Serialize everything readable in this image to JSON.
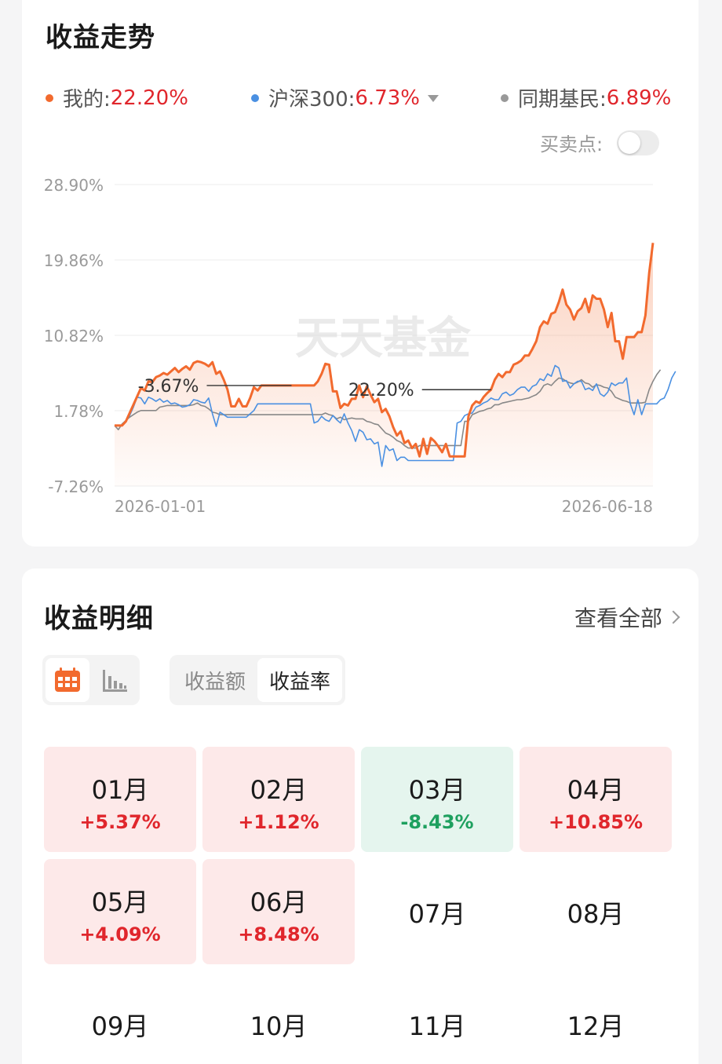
{
  "trend": {
    "title": "收益走势",
    "legend": [
      {
        "dot_color": "#f26a2e",
        "label": "我的:",
        "value": "22.20%"
      },
      {
        "dot_color": "#4a90e2",
        "label": "沪深300:",
        "value": "6.73%",
        "dropdown": true
      },
      {
        "dot_color": "#999999",
        "label": "同期基民:",
        "value": "6.89%"
      }
    ],
    "trade_point_label": "买卖点:",
    "trade_point_enabled": false,
    "watermark": "天天基金"
  },
  "chart_data": {
    "type": "line",
    "y_ticks": [
      "28.90%",
      "19.86%",
      "10.82%",
      "1.78%",
      "-7.26%"
    ],
    "ylim": [
      -7.26,
      28.9
    ],
    "x_tick_labels": [
      "2026-01-01",
      "2026-06-18"
    ],
    "annotations": [
      {
        "text": "22.20%",
        "series": "我的",
        "index": 100
      },
      {
        "text": "-3.67%",
        "series": "我的",
        "index": 47
      }
    ],
    "series": [
      {
        "name": "我的",
        "color": "#f26a2e",
        "values": [
          0,
          0,
          0,
          0.5,
          1.5,
          2.5,
          3.5,
          4.5,
          4.2,
          5.3,
          5.2,
          5.8,
          6,
          6.3,
          6.1,
          6.5,
          6.9,
          6.4,
          6.8,
          7.1,
          6.7,
          7.5,
          7.7,
          7.6,
          7.4,
          7.1,
          7.6,
          6.2,
          6.5,
          5.5,
          4.3,
          2.3,
          2.3,
          3.2,
          2.3,
          2.3,
          3.3,
          4.6,
          4.2,
          4.8,
          4.8,
          4.8,
          4.8,
          4.8,
          4.8,
          4.8,
          4.8,
          4.8,
          4.8,
          4.8,
          4.8,
          4.8,
          4.8,
          4.8,
          5.3,
          6.2,
          7.4,
          7.3,
          4.1,
          4.1,
          2.1,
          2.6,
          2.4,
          3.2,
          3.2,
          4.8,
          3.4,
          4.7,
          3.7,
          2.8,
          3.2,
          1.6,
          2,
          1.1,
          -0.2,
          -1.2,
          -0.7,
          -2.1,
          -1.8,
          -2.7,
          -2.2,
          -3.7,
          -1.6,
          -3.4,
          -1.5,
          -1.9,
          -2.5,
          -3.2,
          -2.2,
          -3.7,
          -3.7,
          -3.7,
          -3.7,
          -3.7,
          1.1,
          2.4,
          2.9,
          2.7,
          3.4,
          3.9,
          4.3,
          5.5,
          6.2,
          5.8,
          6.4,
          6.4,
          7.3,
          7.5,
          7.8,
          8.4,
          8.4,
          9.2,
          10.1,
          11.8,
          12.5,
          12.2,
          13.4,
          13.6,
          14.8,
          16.3,
          14.5,
          13.9,
          12.7,
          13.7,
          14.1,
          15.2,
          13.6,
          15.6,
          15.2,
          15.2,
          13.9,
          11.8,
          13.5,
          10.1,
          10.1,
          8,
          10.6,
          10.6,
          10.6,
          11.2,
          11.2,
          13.2,
          18.3,
          21.9
        ]
      },
      {
        "name": "沪深300",
        "color": "#4a90e2",
        "values": [
          0,
          0,
          0,
          0.5,
          1.2,
          2.2,
          3.4,
          3.3,
          2.6,
          3.4,
          3.2,
          2.9,
          3.2,
          2.8,
          3,
          2.6,
          2.7,
          2.5,
          2.2,
          2.3,
          2.5,
          3.1,
          3,
          2.8,
          2.7,
          3.3,
          1.4,
          -0.1,
          1.6,
          1.3,
          1,
          1,
          1,
          1,
          1,
          1,
          1.4,
          1.8,
          2.6,
          2.6,
          2.6,
          2.6,
          2.6,
          2.6,
          2.6,
          2.6,
          2.6,
          2.6,
          2.6,
          2.6,
          2.6,
          2.6,
          2.6,
          0.3,
          0.5,
          1.1,
          0.7,
          0.5,
          1.2,
          0.7,
          0.3,
          1.4,
          0.3,
          -0.6,
          -1.9,
          -0.5,
          -0.8,
          -1.7,
          -1.6,
          -2.2,
          -2,
          -4.9,
          -2.4,
          -3,
          -2.8,
          -4.2,
          -3.8,
          -3.8,
          -4.2,
          -4.2,
          -4.2,
          -4.2,
          -4.2,
          -4.2,
          -4.2,
          -4.2,
          -4.2,
          -4.2,
          -4.2,
          -4.2,
          -4.2,
          0.3,
          0.5,
          1.2,
          1.4,
          1.5,
          2.2,
          2.4,
          2.7,
          2.9,
          3.3,
          3.1,
          3.1,
          3.8,
          4,
          3.6,
          3.8,
          4.3,
          4.6,
          4.6,
          4.1,
          4.7,
          4.9,
          5.6,
          5.4,
          6.2,
          5.9,
          7.2,
          6.9,
          5.3,
          5.4,
          4.5,
          5,
          5.3,
          5.3,
          4.3,
          4.5,
          4.2,
          5,
          3.8,
          3.5,
          4,
          5.1,
          4.8,
          5.1,
          5.1,
          5.7,
          2.6,
          1.3,
          3.1,
          1.3,
          2.6,
          2.6,
          2.6,
          2.6,
          3.1,
          3.3,
          4.3,
          5.7,
          6.5
        ]
      },
      {
        "name": "同期基民",
        "color": "#888888",
        "values": [
          0,
          -0.5,
          0.2,
          0.6,
          1,
          1.3,
          1.6,
          1.8,
          1.8,
          1.8,
          1.8,
          1.8,
          2.2,
          2.3,
          2.4,
          2.4,
          2.4,
          2.4,
          2.4,
          2.4,
          2.4,
          2.5,
          2.7,
          2.4,
          2.3,
          2,
          1.6,
          1.5,
          1.3,
          1.3,
          1.3,
          1.3,
          1.3,
          1.3,
          1.3,
          1.3,
          1.3,
          1.3,
          1.3,
          1.3,
          1.3,
          1.3,
          1.3,
          1.3,
          1.3,
          1.3,
          1.3,
          1.3,
          1.3,
          1.3,
          1.3,
          1.3,
          1.3,
          1.3,
          1.3,
          1.3,
          1.5,
          1.3,
          1.2,
          0.8,
          1,
          0.7,
          0.8,
          0.9,
          0.8,
          0.8,
          0.8,
          0.5,
          0.4,
          0.2,
          0.1,
          -0.4,
          -0.9,
          -1.1,
          -1.4,
          -1.8,
          -2,
          -2.4,
          -2.7,
          -2.7,
          -2.7,
          -2.4,
          -2.4,
          -2.4,
          -2.4,
          -2.4,
          -2.4,
          -2.4,
          -2.4,
          -2.4,
          -2.4,
          -2.4,
          -2.4,
          0.5,
          0.5,
          1.3,
          1.5,
          1.7,
          1.8,
          2,
          2.1,
          2.5,
          2.5,
          2.7,
          2.8,
          2.9,
          3,
          3.1,
          3.1,
          3.2,
          3.3,
          3.5,
          3.7,
          4.1,
          4.8,
          5,
          4.8,
          5.3,
          5.7,
          5.6,
          5.3,
          5.1,
          5,
          5.2,
          5.5,
          5.1,
          5,
          4.6,
          4.9,
          4.8,
          4.6,
          4.5,
          4.1,
          3.4,
          3.2,
          3,
          2.9,
          2.7,
          2.7,
          2.7,
          2.7,
          2.8,
          4.3,
          5.3,
          6.1,
          6.7
        ]
      }
    ]
  },
  "detail": {
    "title": "收益明细",
    "view_all": "查看全部",
    "view_toggle_active": "calendar-icon",
    "metric_tabs": {
      "amount": "收益额",
      "rate": "收益率",
      "active": "rate"
    },
    "months": [
      {
        "label": "01月",
        "value": "+5.37%",
        "sign": "pos"
      },
      {
        "label": "02月",
        "value": "+1.12%",
        "sign": "pos"
      },
      {
        "label": "03月",
        "value": "-8.43%",
        "sign": "neg"
      },
      {
        "label": "04月",
        "value": "+10.85%",
        "sign": "pos"
      },
      {
        "label": "05月",
        "value": "+4.09%",
        "sign": "pos"
      },
      {
        "label": "06月",
        "value": "+8.48%",
        "sign": "pos"
      },
      {
        "label": "07月",
        "value": "",
        "sign": "empty"
      },
      {
        "label": "08月",
        "value": "",
        "sign": "empty"
      },
      {
        "label": "09月",
        "value": "",
        "sign": "empty"
      },
      {
        "label": "10月",
        "value": "",
        "sign": "empty"
      },
      {
        "label": "11月",
        "value": "",
        "sign": "empty"
      },
      {
        "label": "12月",
        "value": "",
        "sign": "empty"
      }
    ]
  }
}
